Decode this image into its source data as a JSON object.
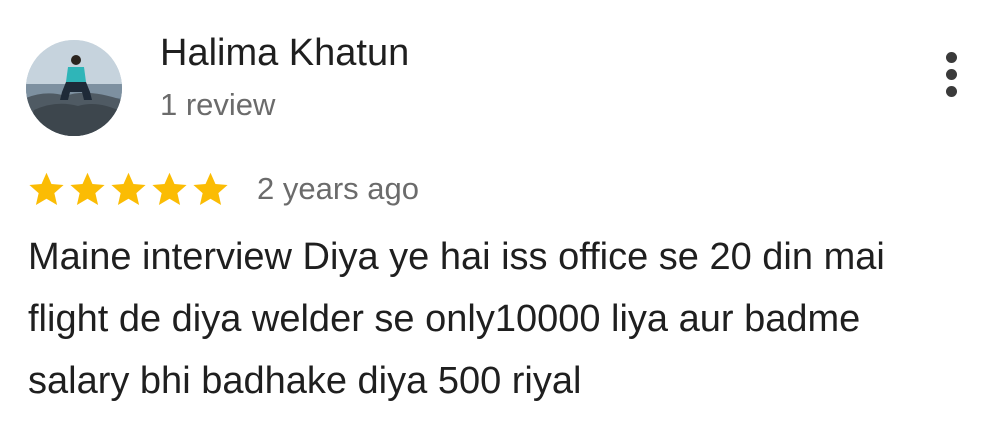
{
  "review": {
    "reviewer_name": "Halima Khatun",
    "review_count": "1 review",
    "rating": 5,
    "max_rating": 5,
    "time_ago": "2 years ago",
    "text": "Maine interview Diya ye hai iss office se 20 din mai flight de diya welder se only10000 liya aur badme salary bhi badhake diya 500 riyal"
  },
  "icons": {
    "avatar": "reviewer-photo",
    "star": "star-icon",
    "more": "more-vertical-icon"
  },
  "colors": {
    "star": "#FBBC04",
    "primary_text": "#1f1f1f",
    "secondary_text": "#6b6b6b"
  }
}
